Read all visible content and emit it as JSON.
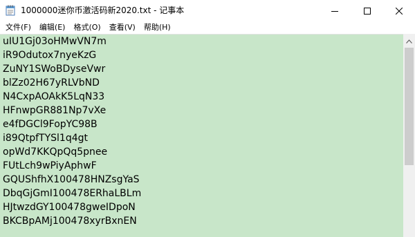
{
  "window": {
    "title": "1000000迷你币激活码新2020.txt - 记事本"
  },
  "menu": [
    {
      "label": "文件(F)"
    },
    {
      "label": "编辑(E)"
    },
    {
      "label": "格式(O)"
    },
    {
      "label": "查看(V)"
    },
    {
      "label": "帮助(H)"
    }
  ],
  "editor": {
    "background_color": "#c8e6c9",
    "lines": [
      "uIU1Gj03oHMwVN7m",
      "iR9Odutox7nyeKzG",
      "ZuNY1SWoBDyseVwr",
      "blZz02H67yRLVbND",
      "N4CxpAOAkK5LqN33",
      "HFnwpGR881Np7vXe",
      "e4fDGCl9FopYC98B",
      "i89QtpfTYSl1q4gt",
      "opWd7KKQpQq5pnee",
      "FUtLch9wPiyAphwF",
      "GQUShfhX100478HNZsgYaS",
      "DbqGjGmI100478ERhaLBLm",
      "HJtwzdGY100478gweIDpoN",
      "BKCBpAMj100478xyrBxnEN"
    ]
  },
  "icons": {
    "app": "notepad-icon",
    "minimize": "minimize-icon",
    "maximize": "maximize-icon",
    "close": "close-icon",
    "scroll_up": "scroll-up-arrow-icon"
  }
}
